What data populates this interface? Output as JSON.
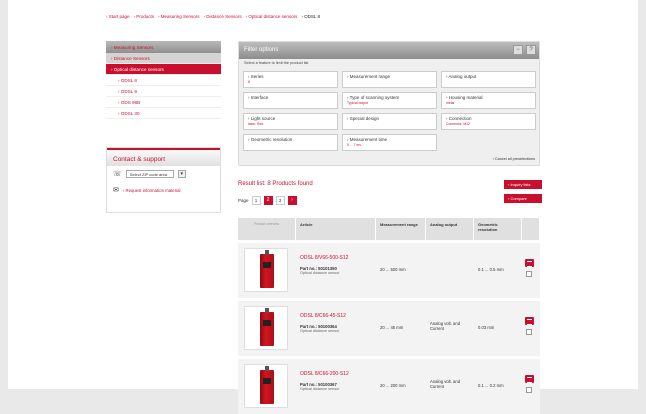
{
  "breadcrumb": [
    "› Start page",
    "› Products",
    "› Measuring Sensors",
    "› Distance Sensors",
    "› Optical distance sensors",
    "› ODSL 8"
  ],
  "sidebar": {
    "items": [
      "› Measuring Sensors",
      "› Distance Sensors",
      "› Optical distance sensors",
      "› ODSL 8",
      "› ODSL 9",
      "› ODS 96B",
      "› ODSL 30"
    ]
  },
  "contact": {
    "title": "Contact & support",
    "zip_placeholder": "Select ZIP code area",
    "request": "› Request information material"
  },
  "filter": {
    "title": "Filter options",
    "hint": "Select a feature to limit the product list",
    "cells": [
      {
        "label": "› Series",
        "value": "8"
      },
      {
        "label": "› Measurement range",
        "value": ""
      },
      {
        "label": "› Analog output",
        "value": ""
      },
      {
        "label": "› Interface",
        "value": ""
      },
      {
        "label": "› Type of scanning system",
        "value": "Typical output"
      },
      {
        "label": "› Housing material",
        "value": "metal"
      },
      {
        "label": "› Light source",
        "value": "laser, Red"
      },
      {
        "label": "› Special design",
        "value": ""
      },
      {
        "label": "› Connection",
        "value": "Connector, M12"
      },
      {
        "label": "› Geometric resolution",
        "value": ""
      },
      {
        "label": "› Measurement time",
        "value": "5 ... 7 ms"
      },
      {
        "label": "",
        "value": ""
      }
    ],
    "cancel": "› Cancel all preselections"
  },
  "results": {
    "title": "Result list: 8 Products found",
    "inquiry": "› Inquiry lists",
    "compare": "› Compare",
    "page_label": "Page",
    "pages": [
      "1",
      "2",
      "3",
      "4"
    ]
  },
  "table": {
    "headers": [
      "Product overview",
      "Article",
      "Measurement range",
      "Analog output",
      "Geometric resolution"
    ],
    "rows": [
      {
        "title": "ODSL 8/V66-500-S12",
        "part": "Part no.: 50101350",
        "desc": "Optical distance sensor",
        "range": "20 ... 500 mm",
        "analog": "",
        "res": "0.1 ... 0.5 mm"
      },
      {
        "title": "ODSL 8/C66-45-S12",
        "part": "Part no.: 50100364",
        "desc": "Optical distance sensor",
        "range": "20 ... 45 mm",
        "analog": "Analog volt. and Current",
        "res": "0.03 mm"
      },
      {
        "title": "ODSL 8/C66-200-S12",
        "part": "Part no.: 50100367",
        "desc": "Optical distance sensor",
        "range": "20 ... 200 mm",
        "analog": "Analog volt. and Current",
        "res": "0.1 ... 0.2 mm"
      }
    ]
  }
}
